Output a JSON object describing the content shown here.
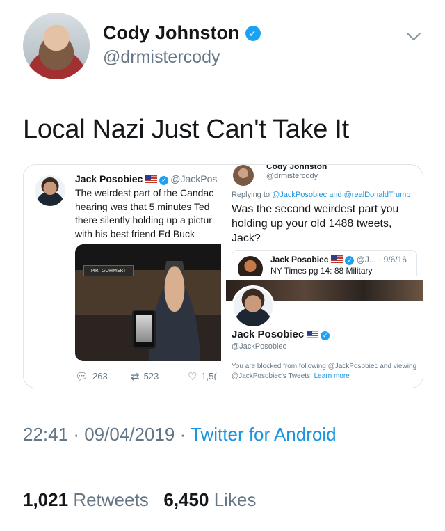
{
  "author": {
    "display_name": "Cody Johnston",
    "handle": "@drmistercody",
    "verified_icon": "verified-badge-icon",
    "menu_icon": "chevron-down-icon"
  },
  "tweet": {
    "text": "Local Nazi Just Can't Take It"
  },
  "embedded": {
    "left": {
      "name": "Jack Posobiec",
      "handle": "@JackPos",
      "lines": [
        "The weirdest part of the Candac",
        "hearing was that 5 minutes Ted",
        "there silently holding up a pictur",
        "with his best friend Ed Buck"
      ],
      "nameplate": "MR. GOHMERT",
      "replies": "263",
      "retweets": "523",
      "likes": "1,5("
    },
    "right_top": {
      "name": "Cody Johnston",
      "handle": "@drmistercody",
      "replying_prefix": "Replying to",
      "replying_targets": "@JackPosobiec and @realDonaldTrump",
      "reply_text": "Was the second weirdest part you\nholding up your old 1488 tweets,\nJack?",
      "quote_name": "Jack Posobiec",
      "quote_meta": "@J... · 9/6/16",
      "quote_text": "NY Times pg 14: 88 Military"
    },
    "right_bottom": {
      "name": "Jack Posobiec",
      "handle": "@JackPosobiec",
      "blocked_text": "You are blocked from following @JackPosobiec and viewing @JackPosobiec's Tweets.",
      "learn_more": "Learn more"
    }
  },
  "meta": {
    "time": "22:41",
    "date": "09/04/2019",
    "separator": "·",
    "source": "Twitter for Android"
  },
  "stats": {
    "retweets_count": "1,021",
    "retweets_label": "Retweets",
    "likes_count": "6,450",
    "likes_label": "Likes"
  },
  "colors": {
    "link": "#1b95e0",
    "verified": "#1da1f2",
    "secondary_text": "#657786"
  }
}
